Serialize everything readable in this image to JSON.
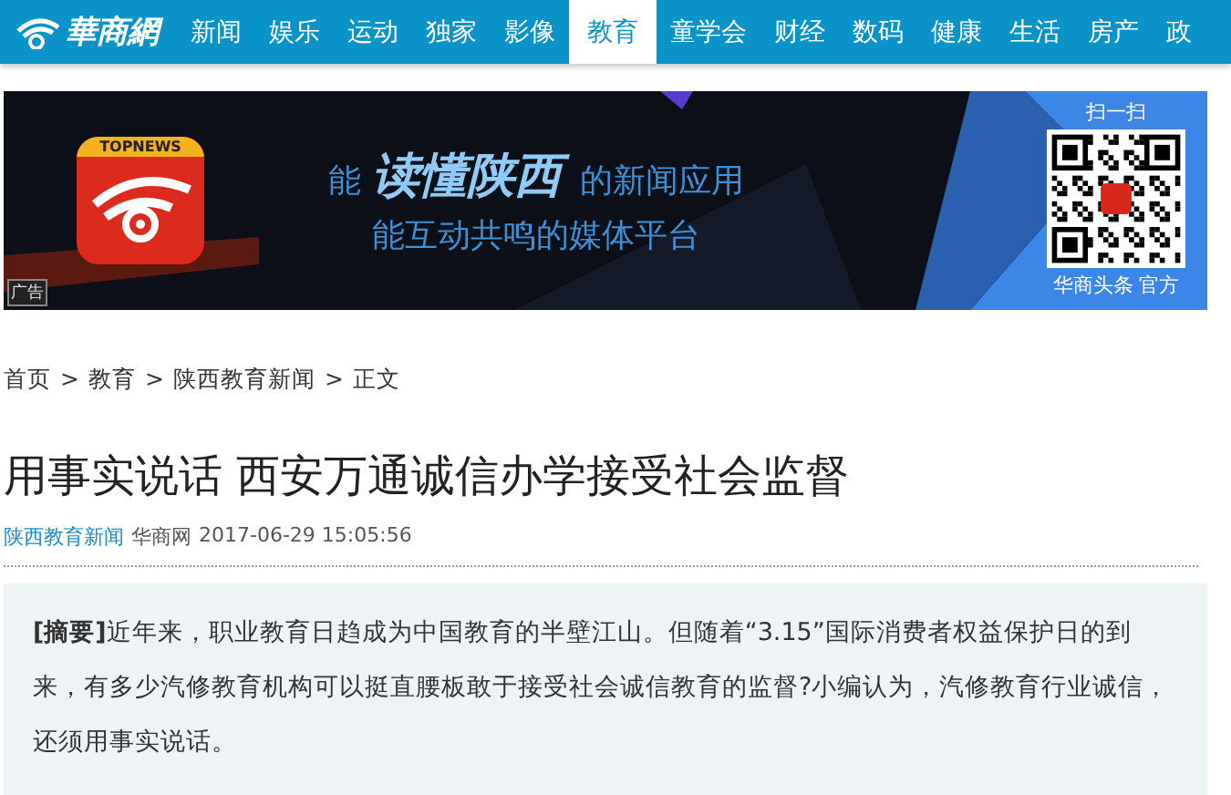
{
  "site_logo": {
    "text": "華商網"
  },
  "nav": [
    {
      "label": "新闻",
      "selected": false
    },
    {
      "label": "娱乐",
      "selected": false
    },
    {
      "label": "运动",
      "selected": false
    },
    {
      "label": "独家",
      "selected": false
    },
    {
      "label": "影像",
      "selected": false
    },
    {
      "label": "教育",
      "selected": true
    },
    {
      "label": "童学会",
      "selected": false
    },
    {
      "label": "财经",
      "selected": false
    },
    {
      "label": "数码",
      "selected": false
    },
    {
      "label": "健康",
      "selected": false
    },
    {
      "label": "生活",
      "selected": false
    },
    {
      "label": "房产",
      "selected": false
    },
    {
      "label": "政",
      "selected": false
    }
  ],
  "banner": {
    "app_badge": "TOPNEWS",
    "lead": "能",
    "highlight": "读懂陕西",
    "tail": "的新闻应用",
    "subline": "能互动共鸣的媒体平台",
    "scan_label": "扫一扫",
    "qr_caption": "华商头条 官方",
    "ad_tag": "广告"
  },
  "breadcrumb": [
    {
      "label": "首页"
    },
    {
      "label": "教育"
    },
    {
      "label": "陕西教育新闻"
    },
    {
      "label": "正文"
    }
  ],
  "breadcrumb_separator": ">",
  "article": {
    "title": "用事实说话 西安万通诚信办学接受社会监督",
    "channel": "陕西教育新闻",
    "source": "华商网",
    "date": "2017-06-29 15:05:56",
    "summary": "**[摘要]**近年来，职业教育日趋成为中国教育的半壁江山。但随着“3.15”国际消费者权益保护日的到来，有多少汽修教育机构可以挺直腰板敢于接受社会诚信教育的监督?小编认为，汽修教育行业诚信，还须用事实说话。"
  }
}
